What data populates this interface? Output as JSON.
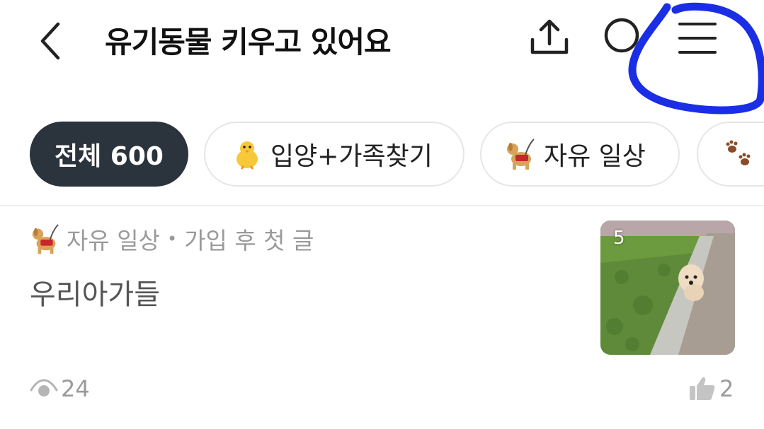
{
  "header": {
    "title": "유기동물 키우고 있어요"
  },
  "icons": {
    "back": "chevron-left-icon",
    "share": "share-upload-icon",
    "search": "search-icon",
    "menu": "hamburger-menu-icon"
  },
  "annotation_color": "#1a2ee6",
  "chips": [
    {
      "label": "전체 600",
      "active": true
    },
    {
      "label": "입양+가족찾기",
      "icon": "chick-emoji",
      "active": false
    },
    {
      "label": "자유 일상",
      "icon": "service-dog-emoji",
      "active": false
    },
    {
      "label": "",
      "icon": "paw-prints-emoji",
      "active": false
    }
  ],
  "post": {
    "board": "자유 일상",
    "tag": "가입 후 첫 글",
    "title": "우리아가들",
    "image_count": "5",
    "views": "24",
    "likes": "2"
  }
}
